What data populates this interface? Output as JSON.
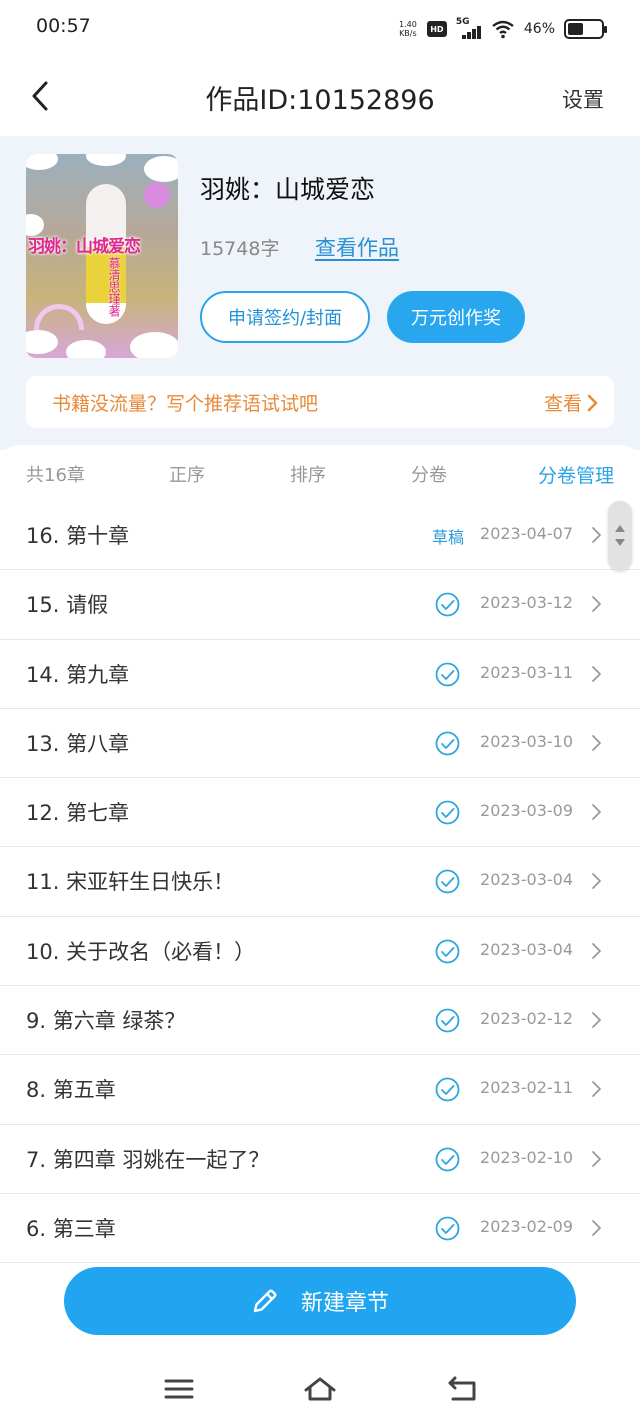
{
  "status_bar": {
    "time": "00:57",
    "net_speed_value": "1.40",
    "net_speed_unit": "KB/s",
    "hd_label": "HD",
    "network_label": "5G",
    "battery_percent": "46%",
    "battery_level": 0.46
  },
  "nav": {
    "title": "作品ID:10152896",
    "settings_label": "设置"
  },
  "book": {
    "title": "羽姚：山城爱恋",
    "word_count": "15748字",
    "view_work_label": "查看作品",
    "apply_sign_label": "申请签约/封面",
    "award_label": "万元创作奖",
    "cover_title": "羽姚：山城爱恋",
    "cover_author": "慕清思瑾著"
  },
  "promo": {
    "text": "书籍没流量？写个推荐语试试吧",
    "link_label": "查看"
  },
  "toolbar": {
    "total": "共16章",
    "order": "正序",
    "sort": "排序",
    "volume": "分卷",
    "manage": "分卷管理"
  },
  "chapters": [
    {
      "title": "16. 第十章",
      "date": "2023-04-07",
      "status": "草稿"
    },
    {
      "title": "15. 请假",
      "date": "2023-03-12",
      "status": ""
    },
    {
      "title": "14. 第九章",
      "date": "2023-03-11",
      "status": ""
    },
    {
      "title": "13. 第八章",
      "date": "2023-03-10",
      "status": ""
    },
    {
      "title": "12. 第七章",
      "date": "2023-03-09",
      "status": ""
    },
    {
      "title": "11. 宋亚轩生日快乐！",
      "date": "2023-03-04",
      "status": ""
    },
    {
      "title": "10. 关于改名（必看！）",
      "date": "2023-03-04",
      "status": ""
    },
    {
      "title": "9. 第六章 绿茶？",
      "date": "2023-02-12",
      "status": ""
    },
    {
      "title": "8. 第五章",
      "date": "2023-02-11",
      "status": ""
    },
    {
      "title": "7. 第四章 羽姚在一起了？",
      "date": "2023-02-10",
      "status": ""
    },
    {
      "title": "6. 第三章",
      "date": "2023-02-09",
      "status": ""
    }
  ],
  "new_chapter_label": "新建章节",
  "colors": {
    "accent": "#29a7ee",
    "promo": "#e98a3a",
    "card_bg": "#eef4fa"
  },
  "icons": {
    "back": "chevron-left-icon",
    "published": "check-circle-icon",
    "row_arrow": "chevron-right-icon",
    "new_chapter": "pencil-icon",
    "sys_menu": "menu-icon",
    "sys_home": "home-icon",
    "sys_back": "back-icon"
  }
}
